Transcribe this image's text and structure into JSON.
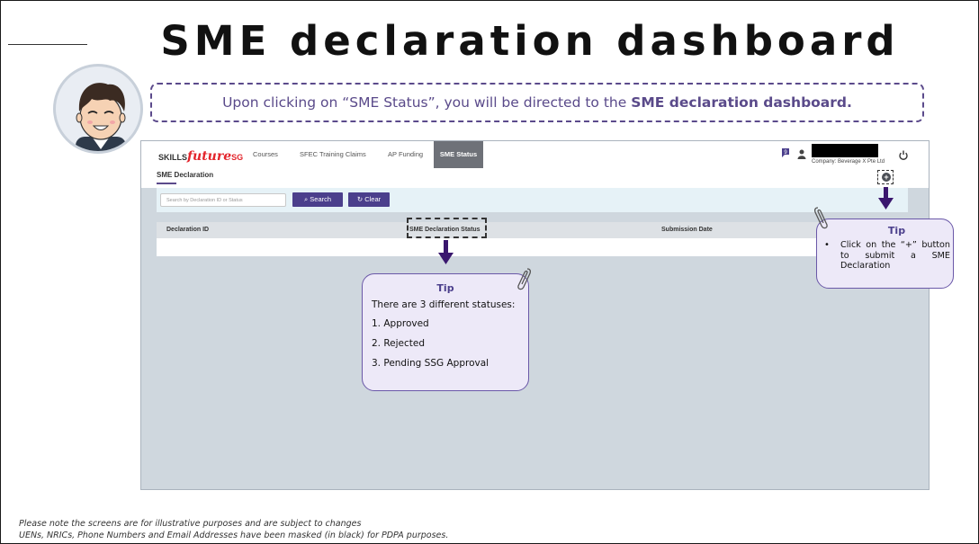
{
  "slide": {
    "title": "SME declaration dashboard",
    "callout_pre": "Upon clicking on “SME Status”, you will be directed to the ",
    "callout_bold": "SME declaration dashboard.",
    "footnote_1": "Please note the screens are for illustrative purposes and are subject to changes",
    "footnote_2": "UENs, NRICs, Phone Numbers and Email Addresses have been masked (in black) for PDPA purposes."
  },
  "app": {
    "logo_skills": "SKILLS",
    "logo_future": "future",
    "logo_sg": "SG",
    "nav": {
      "courses": "Courses",
      "claims": "SFEC Training Claims",
      "ap_funding": "AP Funding",
      "sme_status": "SME Status"
    },
    "company": "Company: Beverage X Pte Ltd",
    "page_title": "SME Declaration",
    "search": {
      "placeholder": "Search by Declaration ID or Status",
      "search_label": "Search",
      "clear_label": "Clear"
    },
    "table": {
      "columns": [
        "Declaration ID",
        "SME Declaration Status",
        "Submission Date"
      ]
    },
    "icons": [
      "notification-icon",
      "user-icon",
      "power-icon",
      "add-icon",
      "search-icon",
      "refresh-icon"
    ]
  },
  "tips": {
    "center": {
      "title": "Tip",
      "intro": "There are 3 different statuses:",
      "items": [
        "1.  Approved",
        "2.  Rejected",
        "3.  Pending SSG Approval"
      ]
    },
    "right": {
      "title": "Tip",
      "bullet": "•",
      "text": "Click on the “+” button to submit a SME Declaration"
    }
  },
  "colors": {
    "accent": "#4b3f8c",
    "callout": "#5a4a8a",
    "active_tab": "#6e7178",
    "arrow": "#3a176e",
    "logo_red": "#e3242b"
  }
}
